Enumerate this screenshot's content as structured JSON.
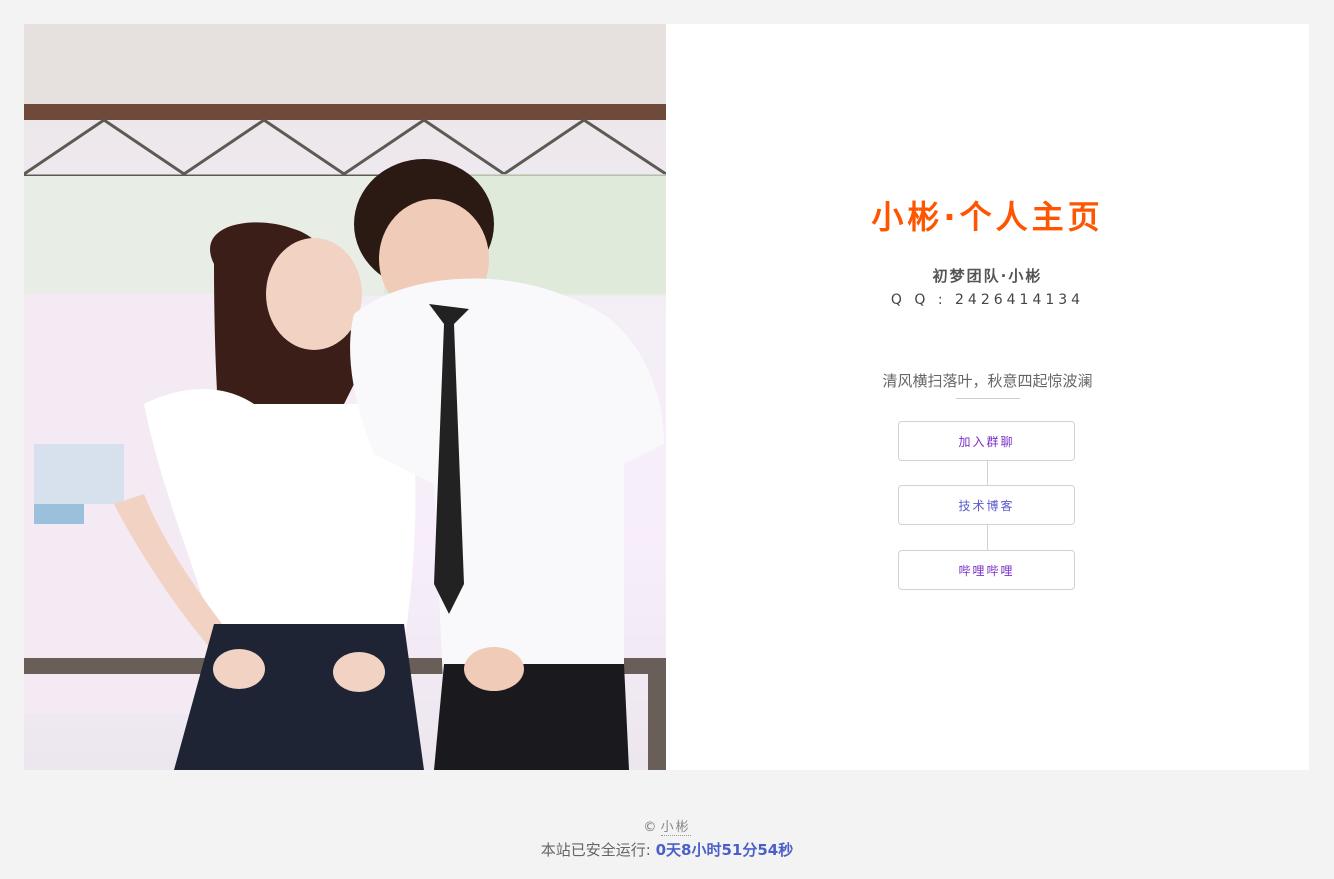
{
  "profile": {
    "title": "小彬·个人主页",
    "team": "初梦团队·小彬",
    "qq": "Q Q : 2426414134",
    "motto": "清风横扫落叶，秋意四起惊波澜"
  },
  "links": [
    {
      "label": "加入群聊"
    },
    {
      "label": "技术博客"
    },
    {
      "label": "哔哩哔哩"
    }
  ],
  "footer": {
    "copyright_symbol": "©",
    "author": "小彬",
    "runtime_label": "本站已安全运行: ",
    "runtime_value": "0天8小时51分54秒"
  },
  "colors": {
    "title": "#ff5500",
    "runtime": "#4b5fc9",
    "link": "#7b2fc9"
  }
}
